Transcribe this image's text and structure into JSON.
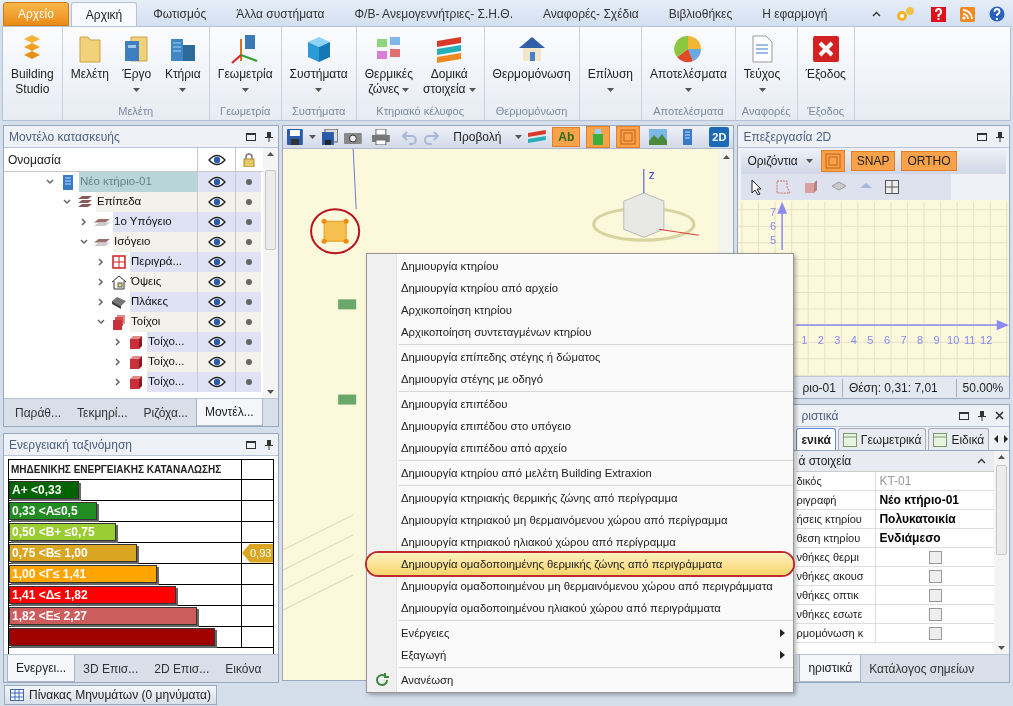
{
  "tabs": [
    {
      "label": "Αρχείο",
      "kind": "file",
      "selected": false
    },
    {
      "label": "Αρχική",
      "kind": "tab",
      "selected": true
    },
    {
      "label": "Φωτισμός",
      "kind": "tab",
      "selected": false
    },
    {
      "label": "Άλλα συστήματα",
      "kind": "tab",
      "selected": false
    },
    {
      "label": "Φ/Β- Ανεμογεννήτριες- Σ.Η.Θ.",
      "kind": "tab",
      "selected": false
    },
    {
      "label": "Αναφορές- Σχέδια",
      "kind": "tab",
      "selected": false
    },
    {
      "label": "Βιβλιοθήκες",
      "kind": "tab",
      "selected": false
    },
    {
      "label": "Η εφαρμογή",
      "kind": "tab",
      "selected": false
    }
  ],
  "ribbon_groups": [
    {
      "buttons": [
        {
          "lines": [
            "Building",
            "Studio"
          ],
          "dropdown": false
        }
      ]
    },
    {
      "label": "Μελέτη",
      "buttons": [
        {
          "lines": [
            "Μελέτη"
          ],
          "dropdown": false
        },
        {
          "lines": [
            "Έργο"
          ],
          "dropdown": true
        },
        {
          "lines": [
            "Κτήρια"
          ],
          "dropdown": true
        }
      ]
    },
    {
      "label": "Γεωμετρία",
      "buttons": [
        {
          "lines": [
            "Γεωμετρία"
          ],
          "dropdown": true
        }
      ]
    },
    {
      "label": "Συστήματα",
      "buttons": [
        {
          "lines": [
            "Συστήματα"
          ],
          "dropdown": true
        }
      ]
    },
    {
      "label": "Κτηριακό κέλυφος",
      "buttons": [
        {
          "lines": [
            "Θερμικές",
            "ζώνες"
          ],
          "dropdown": true
        },
        {
          "lines": [
            "Δομικά",
            "στοιχεία"
          ],
          "dropdown": true
        }
      ]
    },
    {
      "label": "Θερμομόνωση",
      "buttons": [
        {
          "lines": [
            "Θερμομόνωση"
          ],
          "dropdown": false
        }
      ]
    },
    {
      "buttons": [
        {
          "lines": [
            "Επίλυση"
          ],
          "dropdown": true
        }
      ]
    },
    {
      "label": "Αποτελέσματα",
      "buttons": [
        {
          "lines": [
            "Αποτελέσματα"
          ],
          "dropdown": true
        }
      ]
    },
    {
      "label": "Αναφορές",
      "buttons": [
        {
          "lines": [
            "Τεύχος"
          ],
          "dropdown": true
        }
      ]
    },
    {
      "label": "Έξοδος",
      "buttons": [
        {
          "lines": [
            "Έξοδος"
          ],
          "dropdown": false
        }
      ]
    }
  ],
  "model_panel": {
    "title": "Μοντέλο κατασκευής",
    "column": "Ονομασία",
    "tree": [
      {
        "label": "Νέο κτήριο-01",
        "kind": "building",
        "selected": true,
        "expanded": true,
        "children": [
          {
            "label": "Επίπεδα",
            "kind": "levels",
            "selected": false,
            "expanded": true,
            "children": [
              {
                "label": "1ο Υπόγειο",
                "kind": "level",
                "selected": false,
                "expanded": false
              },
              {
                "label": "Ισόγειο",
                "kind": "level",
                "selected": false,
                "expanded": true,
                "children": [
                  {
                    "label": "Περιγρά...",
                    "kind": "outline",
                    "selected": false,
                    "expanded": false
                  },
                  {
                    "label": "Όψεις",
                    "kind": "views",
                    "selected": false,
                    "expanded": false
                  },
                  {
                    "label": "Πλάκες",
                    "kind": "slabs",
                    "selected": false,
                    "expanded": false
                  },
                  {
                    "label": "Τοίχοι",
                    "kind": "walls",
                    "selected": false,
                    "expanded": true,
                    "children": [
                      {
                        "label": "Τοίχο...",
                        "kind": "wall",
                        "selected": false,
                        "expanded": false
                      },
                      {
                        "label": "Τοίχο...",
                        "kind": "wall",
                        "selected": false,
                        "expanded": false
                      },
                      {
                        "label": "Τοίχο...",
                        "kind": "wall",
                        "selected": false,
                        "expanded": false
                      }
                    ]
                  }
                ]
              }
            ]
          }
        ]
      }
    ],
    "tabs": [
      {
        "label": "Παράθ...",
        "selected": false
      },
      {
        "label": "Τεκμηρί...",
        "selected": false
      },
      {
        "label": "Ριζόχα...",
        "selected": false
      },
      {
        "label": "Μοντέλ...",
        "selected": true
      }
    ]
  },
  "energy_panel": {
    "title": "Ενεργειακή ταξινόμηση",
    "heading": "ΜΗΔΕΝΙΚΗΣ ΕΝΕΡΓΕΙΑΚΗΣ ΚΑΤΑΝΑΛΩΣΗΣ",
    "rows": [
      {
        "label": "A+ <0,33",
        "color": "#006400",
        "level": 0.3
      },
      {
        "label": "0,33 <A≤0,5",
        "color": "#228b22",
        "level": 0.38
      },
      {
        "label": "0,50 <B+ ≤0,75",
        "color": "#9acd32",
        "level": 0.46
      },
      {
        "label": "0,75 <B≤ 1,00",
        "color": "#daa520",
        "level": 0.55,
        "indicator": "0,93"
      },
      {
        "label": "1,00 <Γ≤ 1,41",
        "color": "#ffa500",
        "level": 0.64
      },
      {
        "label": "1,41 <Δ≤ 1,82",
        "color": "#ff0000",
        "level": 0.72
      },
      {
        "label": "1,82 <Ε≤ 2,27",
        "color": "#cd5c5c",
        "level": 0.81
      },
      {
        "color": "#a00000",
        "level": 0.89
      }
    ],
    "tabs": [
      {
        "label": "Ενεργει...",
        "selected": true
      },
      {
        "label": "3D Επισ...",
        "selected": false
      },
      {
        "label": "2D Επισ...",
        "selected": false
      },
      {
        "label": "Εικόνα",
        "selected": false
      }
    ]
  },
  "view_toolbar": {
    "view_label": "Προβολή",
    "toggles": [
      {
        "kind": "text",
        "label": "Ab",
        "on": true
      },
      {
        "kind": "solid",
        "on": true
      },
      {
        "kind": "layers",
        "on": true
      },
      {
        "kind": "landscape",
        "on": false
      },
      {
        "kind": "building",
        "on": false
      }
    ],
    "mode_label": "2D"
  },
  "scene": {
    "axis_label": "z"
  },
  "context_menu": {
    "groups": [
      [
        {
          "label": "Δημιουργία κτηρίου",
          "selected": false
        },
        {
          "label": "Δημιουργία κτηρίου από αρχείο",
          "selected": false
        },
        {
          "label": "Αρχικοποίηση κτηρίου",
          "selected": false
        },
        {
          "label": "Αρχικοποίηση συντεταγμένων κτηρίου",
          "selected": false
        }
      ],
      [
        {
          "label": "Δημιουργία επίπεδης στέγης ή δώματος",
          "selected": false
        },
        {
          "label": "Δημιουργία στέγης με οδηγό",
          "selected": false
        }
      ],
      [
        {
          "label": "Δημιουργία επιπέδου",
          "selected": false
        },
        {
          "label": "Δημιουργία επιπέδου στο υπόγειο",
          "selected": false
        },
        {
          "label": "Δημιουργία επιπέδου από αρχείο",
          "selected": false
        }
      ],
      [
        {
          "label": "Δημιουργία κτηρίου από μελέτη Building Extraxion",
          "selected": false
        }
      ],
      [
        {
          "label": "Δημιουργία κτηριακής θερμικής ζώνης από περίγραμμα",
          "selected": false
        },
        {
          "label": "Δημιουργία κτηριακού μη θερμαινόμενου χώρου από περίγραμμα",
          "selected": false
        },
        {
          "label": "Δημιουργία κτηριακού ηλιακού χώρου από περίγραμμα",
          "selected": false
        },
        {
          "label": "Δημιουργία ομαδοποιημένης θερμικής ζώνης από περιγράμματα",
          "selected": true
        },
        {
          "label": "Δημιουργία ομαδοποιημένου μη θερμαινόμενου χώρου από περιγράμματα",
          "selected": false
        },
        {
          "label": "Δημιουργία ομαδοποιημένου ηλιακού χώρου από περιγράμματα",
          "selected": false
        }
      ],
      [
        {
          "label": "Ενέργειες",
          "selected": false,
          "submenu": true
        },
        {
          "label": "Εξαγωγή",
          "selected": false,
          "submenu": true
        }
      ],
      [
        {
          "label": "Ανανέωση",
          "selected": false,
          "has_icon": true
        }
      ]
    ]
  },
  "editor_2d": {
    "title": "Επεξεργασία 2D",
    "plane": "Οριζόντια",
    "toggles": [
      {
        "kind": "layers",
        "on": true
      },
      {
        "kind": "text",
        "label": "SNAP",
        "on": true
      },
      {
        "kind": "text",
        "label": "ORTHO",
        "on": true
      }
    ],
    "y_labels": [
      "7",
      "6",
      "5"
    ],
    "x_labels": [
      "1",
      "2",
      "3",
      "4",
      "5",
      "6",
      "7",
      "8",
      "9",
      "10",
      "11",
      "12"
    ],
    "status": [
      "ριο-01",
      "Θέση: 0,31: 7,01",
      "50.00%"
    ]
  },
  "properties": {
    "title": "ριστικά",
    "tabs": [
      {
        "label": "ενικά",
        "selected": true
      },
      {
        "label": "Γεωμετρικά",
        "selected": false
      },
      {
        "label": "Ειδικά",
        "selected": false
      }
    ],
    "group": "ά στοιχεία",
    "rows": [
      {
        "kind": "text",
        "label": "δικός",
        "value": "KT-01",
        "readonly": true
      },
      {
        "kind": "text",
        "label": "ριγραφή",
        "value": "Νέο κτήριο-01",
        "readonly": false
      },
      {
        "kind": "text",
        "label": "ήσεις κτηρίου",
        "value": "Πολυκατοικία",
        "readonly": false
      },
      {
        "kind": "text",
        "label": "θεση κτηρίου",
        "value": "Ενδιάμεσο",
        "readonly": false
      },
      {
        "kind": "check",
        "label": "νθήκες θερμι",
        "checked": false
      },
      {
        "kind": "check",
        "label": "νθήκες ακουσ",
        "checked": false
      },
      {
        "kind": "check",
        "label": "νθήκες οπτικ",
        "checked": false
      },
      {
        "kind": "check",
        "label": "νθήκες εσωτε",
        "checked": false
      },
      {
        "kind": "check",
        "label": "ρμομόνωση κ",
        "checked": false
      }
    ],
    "bottom_tabs": [
      {
        "label": "ηριστικά",
        "selected": true
      },
      {
        "label": "Κατάλογος σημείων",
        "selected": false
      }
    ]
  },
  "status_bar": {
    "messages_button": "Πίνακας Μηνυμάτων (0 μηνύματα)"
  }
}
